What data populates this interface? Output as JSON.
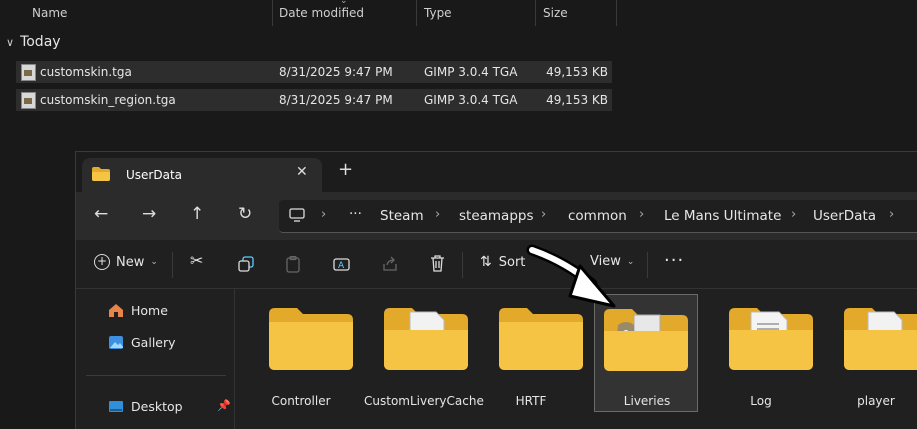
{
  "list": {
    "columns": [
      "Name",
      "Date modified",
      "Type",
      "Size"
    ],
    "group": "Today",
    "files": [
      {
        "name": "customskin.tga",
        "date": "8/31/2025 9:47 PM",
        "type": "GIMP 3.0.4 TGA",
        "size": "49,153 KB"
      },
      {
        "name": "customskin_region.tga",
        "date": "8/31/2025 9:47 PM",
        "type": "GIMP 3.0.4 TGA",
        "size": "49,153 KB"
      }
    ]
  },
  "window": {
    "tab_title": "UserData",
    "breadcrumb": [
      "Steam",
      "steamapps",
      "common",
      "Le Mans Ultimate",
      "UserData"
    ],
    "toolbar": {
      "new": "New",
      "sort": "Sort",
      "view": "View"
    },
    "sidebar": [
      "Home",
      "Gallery",
      "Desktop"
    ],
    "folders": [
      "Controller",
      "CustomLiveryCache",
      "HRTF",
      "Liveries",
      "Log",
      "player"
    ],
    "selected_folder": "Liveries"
  },
  "colors": {
    "folder": "#f6c445",
    "folder_dark": "#e3a92a",
    "accent": "#60cdff"
  }
}
